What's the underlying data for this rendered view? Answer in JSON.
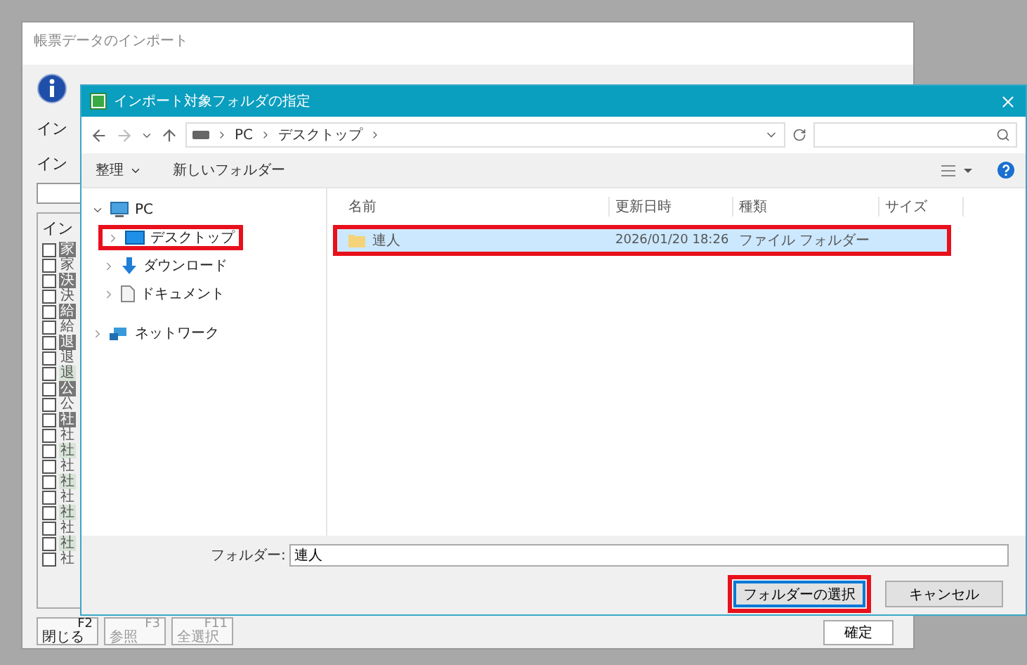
{
  "main_window": {
    "title": "帳票データのインポート",
    "labels": [
      "イン",
      "イン"
    ],
    "group_label": "イン",
    "checkboxes": [
      {
        "char": "家",
        "checked": false,
        "kind": "dark"
      },
      {
        "char": "家",
        "checked": false,
        "kind": "plain"
      },
      {
        "char": "決",
        "checked": false,
        "kind": "dark"
      },
      {
        "char": "決",
        "checked": false,
        "kind": "plain"
      },
      {
        "char": "給",
        "checked": false,
        "kind": "dark"
      },
      {
        "char": "給",
        "checked": false,
        "kind": "plain"
      },
      {
        "char": "退",
        "checked": false,
        "kind": "dark"
      },
      {
        "char": "退",
        "checked": false,
        "kind": "plain"
      },
      {
        "char": "退",
        "checked": false,
        "kind": "light"
      },
      {
        "char": "公",
        "checked": false,
        "kind": "dark"
      },
      {
        "char": "公",
        "checked": false,
        "kind": "plain"
      },
      {
        "char": "社",
        "checked": false,
        "kind": "dark"
      },
      {
        "char": "社",
        "checked": false,
        "kind": "plain"
      },
      {
        "char": "社",
        "checked": false,
        "kind": "light"
      },
      {
        "char": "社",
        "checked": false,
        "kind": "plain"
      },
      {
        "char": "社",
        "checked": false,
        "kind": "light"
      },
      {
        "char": "社",
        "checked": false,
        "kind": "plain"
      },
      {
        "char": "社",
        "checked": false,
        "kind": "light"
      },
      {
        "char": "社",
        "checked": false,
        "kind": "plain"
      },
      {
        "char": "社",
        "checked": false,
        "kind": "light"
      },
      {
        "char": "社",
        "checked": false,
        "kind": "plain"
      }
    ],
    "buttons": [
      {
        "key": "F2",
        "label": "閉じる",
        "disabled": false
      },
      {
        "key": "F3",
        "label": "参照",
        "disabled": true
      },
      {
        "key": "F11",
        "label": "全選択",
        "disabled": true
      }
    ],
    "confirm": "確定"
  },
  "dialog": {
    "title": "インポート対象フォルダの指定",
    "address": [
      "PC",
      "デスクトップ"
    ],
    "organize": "整理",
    "new_folder": "新しいフォルダー",
    "tree": [
      {
        "label": "PC",
        "kind": "pc",
        "expanded": true,
        "highlighted": false,
        "children": [
          {
            "label": "デスクトップ",
            "kind": "desktop",
            "expanded": false,
            "highlighted": true
          },
          {
            "label": "ダウンロード",
            "kind": "download",
            "expanded": false,
            "highlighted": false
          },
          {
            "label": "ドキュメント",
            "kind": "document",
            "expanded": false,
            "highlighted": false
          }
        ]
      },
      {
        "label": "ネットワーク",
        "kind": "network",
        "expanded": false,
        "highlighted": false
      }
    ],
    "columns": [
      "名前",
      "更新日時",
      "種類",
      "サイズ"
    ],
    "files": [
      {
        "name": "連人",
        "modified": "2026/01/20 18:26",
        "type": "ファイル フォルダー",
        "selected": true,
        "highlighted": true
      }
    ],
    "folder_label": "フォルダー:",
    "folder_value": "連人",
    "buttons": [
      {
        "label": "フォルダーの選択",
        "default": true,
        "highlighted": true
      },
      {
        "label": "キャンセル",
        "default": false,
        "highlighted": false
      }
    ]
  }
}
